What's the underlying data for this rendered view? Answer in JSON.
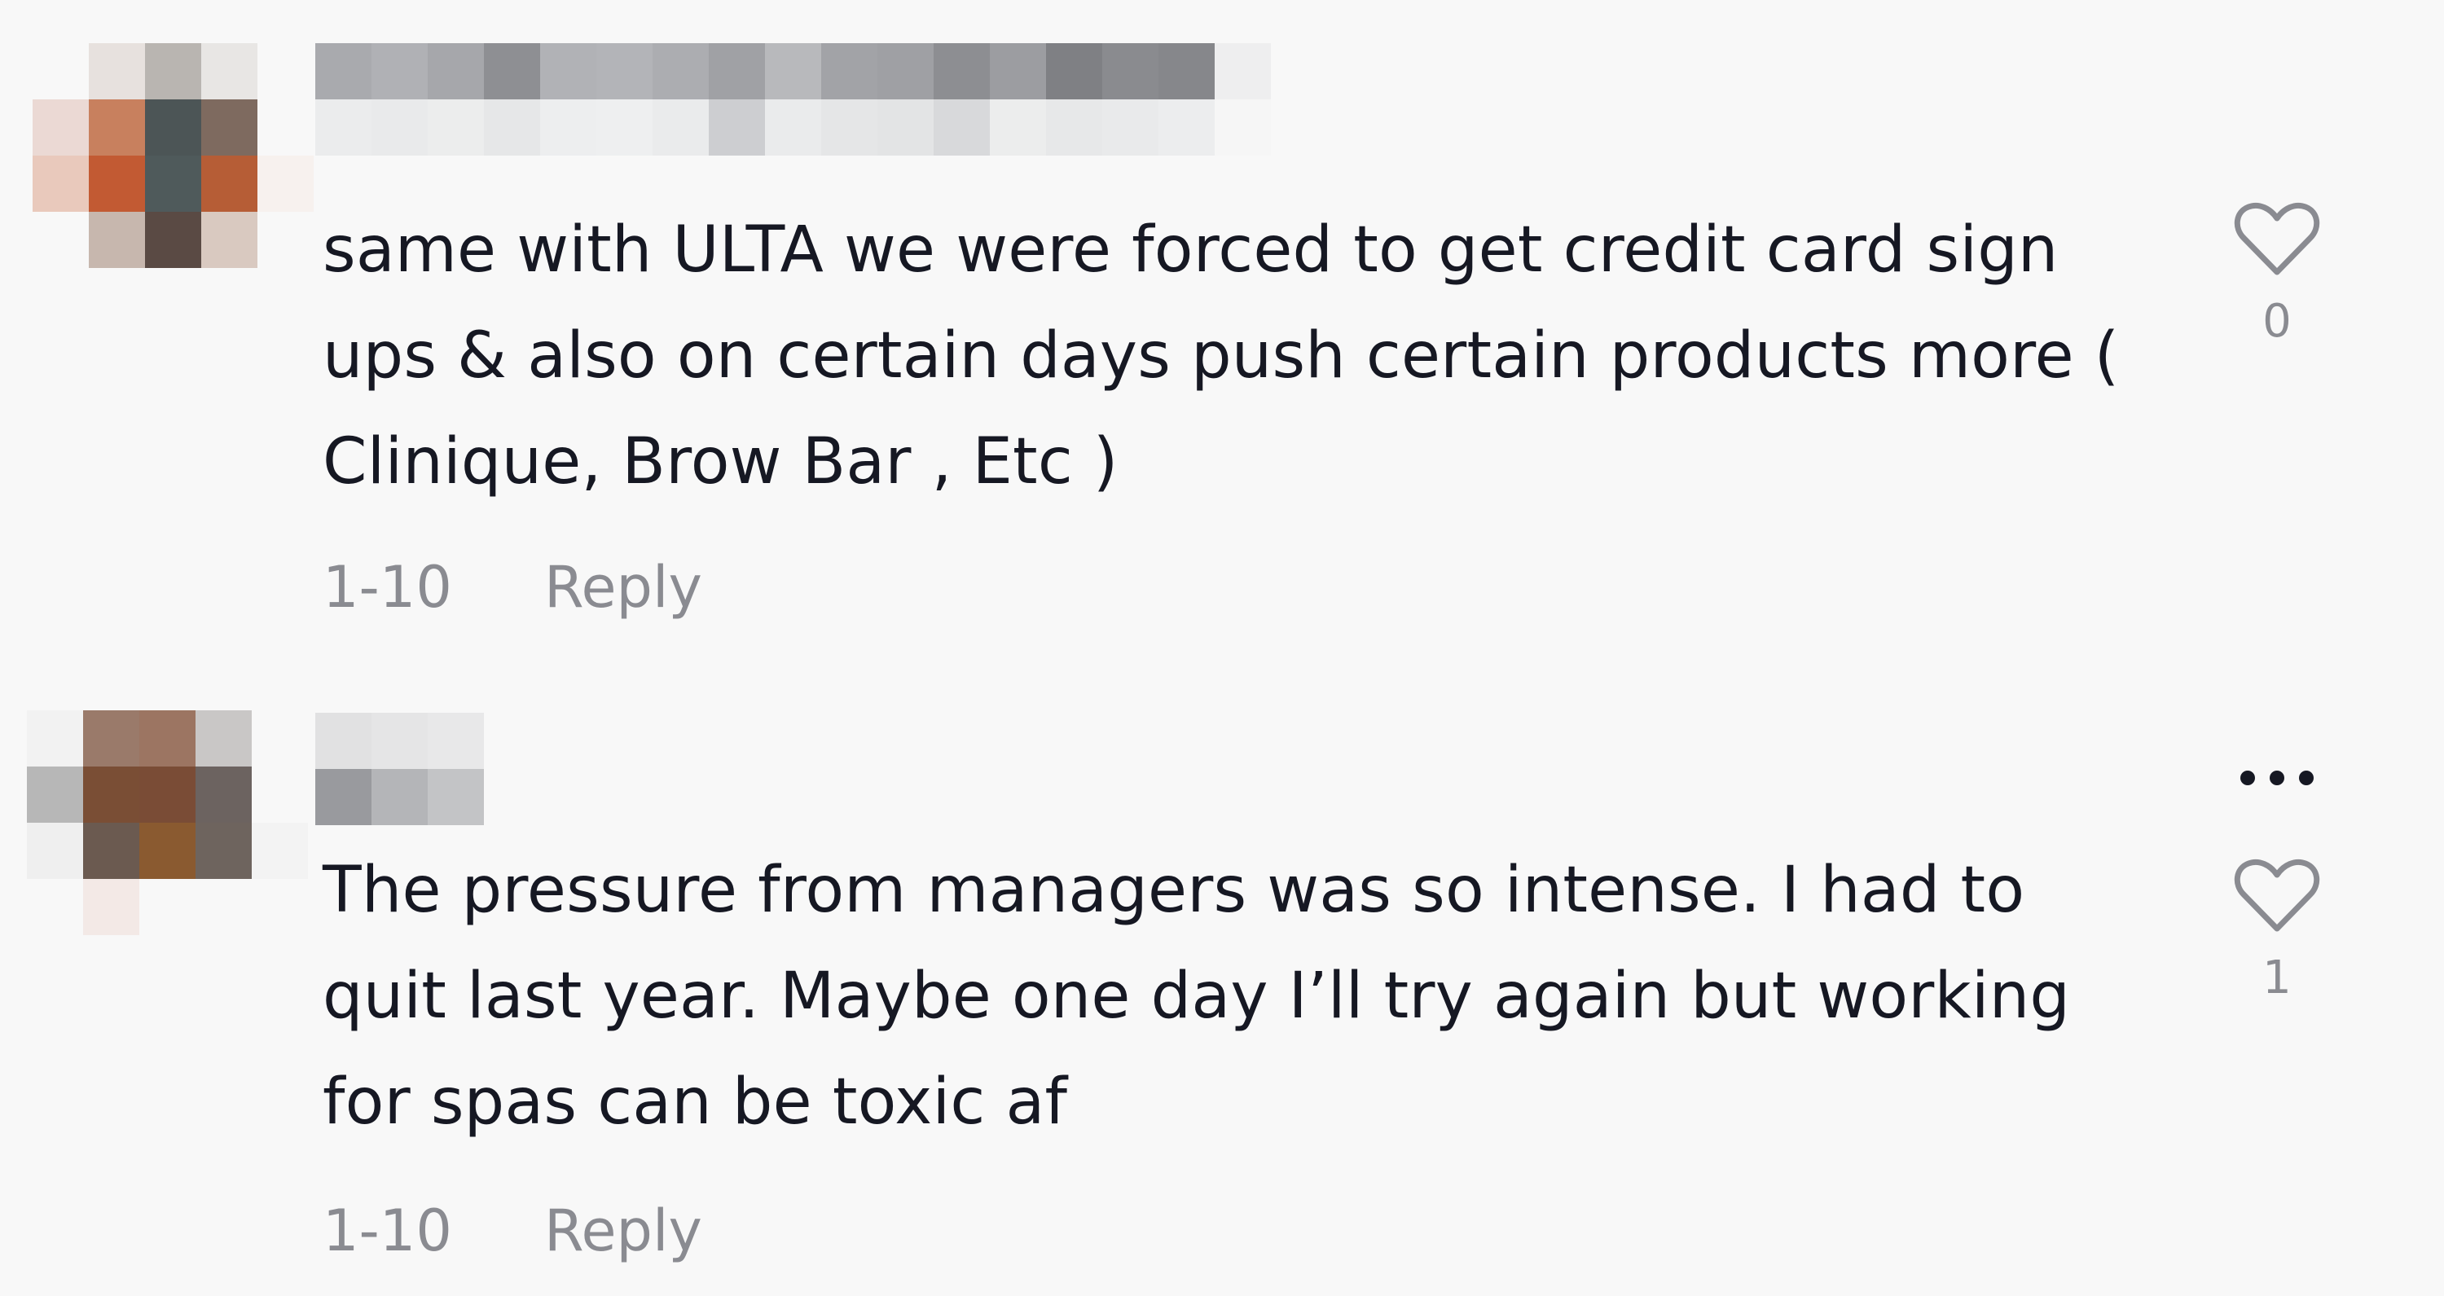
{
  "comments": [
    {
      "text": "same with ULTA we were forced to get credit card sign ups & also on certain days push certain products more ( Clinique, Brow Bar , Etc )",
      "date": "1-10",
      "reply_label": "Reply",
      "like_count": "0",
      "heart_icon": "heart-outline-icon",
      "avatar_pixels": [
        [
          "#f8f8f8",
          "#e7e1de",
          "#b9b5b1",
          "#e8e6e4",
          "#f8f8f8"
        ],
        [
          "#ebd9d4",
          "#c8805e",
          "#4c5556",
          "#7e6a5f",
          "#f8f8f8"
        ],
        [
          "#e9c9bc",
          "#c25a33",
          "#4f5a5b",
          "#b65d36",
          "#f7f1ee"
        ],
        [
          "#f8f8f8",
          "#c7b7ae",
          "#5a4a44",
          "#d9c9c0",
          "#f8f8f8"
        ],
        [
          "#f8f8f8",
          "#f8f8f8",
          "#f8f8f8",
          "#f8f8f8",
          "#f8f8f8"
        ]
      ],
      "username_pixels": [
        [
          "#a9aaae",
          "#ebeced"
        ],
        [
          "#b0b1b5",
          "#e9eaeb"
        ],
        [
          "#a6a7ab",
          "#eceded"
        ],
        [
          "#8e8f93",
          "#e6e7e8"
        ],
        [
          "#b1b2b6",
          "#edeeef"
        ],
        [
          "#b3b4b8",
          "#eeeff0"
        ],
        [
          "#acadb1",
          "#eaebec"
        ],
        [
          "#a0a1a5",
          "#cdced1"
        ],
        [
          "#b8b9bc",
          "#eaebec"
        ],
        [
          "#a2a3a7",
          "#e5e6e7"
        ],
        [
          "#9fa0a4",
          "#e3e4e5"
        ],
        [
          "#8d8e92",
          "#d8d9db"
        ],
        [
          "#9c9da1",
          "#eceded"
        ],
        [
          "#7f8084",
          "#e7e8e9"
        ],
        [
          "#8a8b8f",
          "#e9eaeb"
        ],
        [
          "#86878b",
          "#ecedee"
        ],
        [
          "#eeeeef",
          "#f6f6f6"
        ]
      ]
    },
    {
      "text": "The pressure from managers was so intense. I had to quit last year. Maybe one day I’ll try again but working for spas can be toxic af",
      "date": "1-10",
      "reply_label": "Reply",
      "like_count": "1",
      "heart_icon": "heart-outline-icon",
      "more_icon": "more-options-icon",
      "avatar_pixels": [
        [
          "#f2f2f2",
          "#9a7a6a",
          "#9c7562",
          "#c9c7c6",
          "#f8f8f8"
        ],
        [
          "#b7b7b7",
          "#7a4e35",
          "#7a4c36",
          "#6c6360",
          "#f8f8f8"
        ],
        [
          "#efefef",
          "#6b5a50",
          "#8a5a30",
          "#6e645e",
          "#f3f3f3"
        ],
        [
          "#f8f8f8",
          "#f3e9e6",
          "#f8f8f8",
          "#f8f8f8",
          "#f8f8f8"
        ],
        [
          "#f8f8f8",
          "#f8f8f8",
          "#f8f8f8",
          "#f8f8f8",
          "#f8f8f8"
        ]
      ],
      "username_pixels": [
        [
          "#e1e1e2",
          "#999a9e"
        ],
        [
          "#e5e5e6",
          "#b4b5b8"
        ],
        [
          "#e8e8e9",
          "#c3c4c6"
        ]
      ]
    }
  ]
}
